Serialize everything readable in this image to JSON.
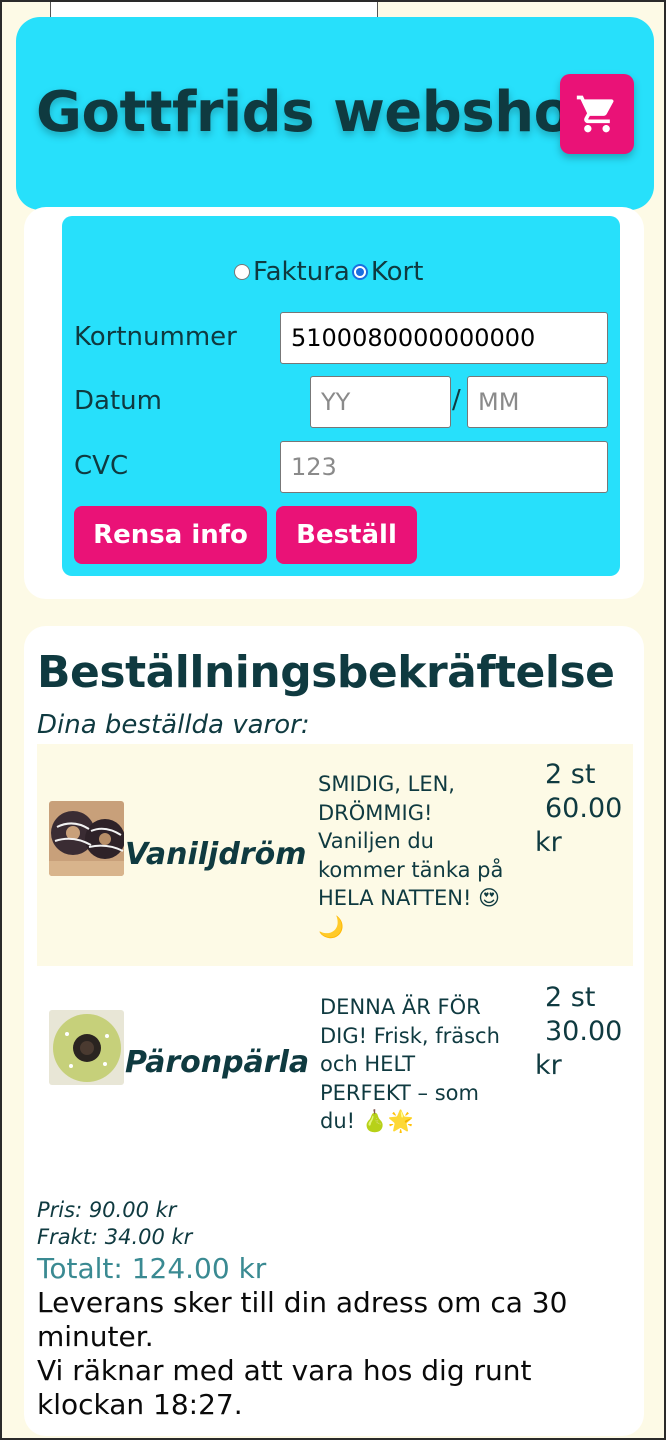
{
  "header": {
    "title": "Gottfrids webshop",
    "cart_icon": "shopping-cart-icon"
  },
  "payment": {
    "options": [
      {
        "label": "Faktura",
        "checked": false
      },
      {
        "label": "Kort",
        "checked": true
      }
    ],
    "card_number_label": "Kortnummer",
    "card_number_value": "5100080000000000",
    "date_label": "Datum",
    "date_year_placeholder": "YY",
    "date_separator": "/",
    "date_month_placeholder": "MM",
    "cvc_label": "CVC",
    "cvc_placeholder": "123",
    "clear_button": "Rensa info",
    "order_button": "Beställ"
  },
  "confirmation": {
    "title": "Beställningsbekräftelse",
    "subtitle": "Dina beställda varor:",
    "items": [
      {
        "name": "Vaniljdröm",
        "desc_lines": [
          "SMIDIG, LEN,",
          "DRÖMMIG!",
          "Vaniljen du",
          "kommer tänka på",
          "HELA NATTEN! 😍",
          "🌙"
        ],
        "qty": "2 st",
        "price": "60.00",
        "currency": "kr"
      },
      {
        "name": "Päronpärla",
        "desc_lines": [
          "DENNA ÄR FÖR",
          "DIG! Frisk, fräsch",
          "och HELT",
          "PERFEKT – som",
          "du! 🍐🌟"
        ],
        "qty": "2 st",
        "price": "30.00",
        "currency": "kr"
      }
    ],
    "price_line": "Pris: 90.00 kr",
    "shipping_line": "Frakt: 34.00 kr",
    "total_line": "Totalt: 124.00 kr",
    "delivery_lines": [
      "Leverans sker till din adress om ca 30 minuter.",
      "Vi räknar med att vara hos dig runt klockan 18:27."
    ]
  },
  "colors": {
    "header_bg": "#27e0fb",
    "accent_pink": "#ea1277",
    "page_bg": "#fdfae6",
    "text_dark": "#0f3a40",
    "total_teal": "#3a8a92"
  }
}
